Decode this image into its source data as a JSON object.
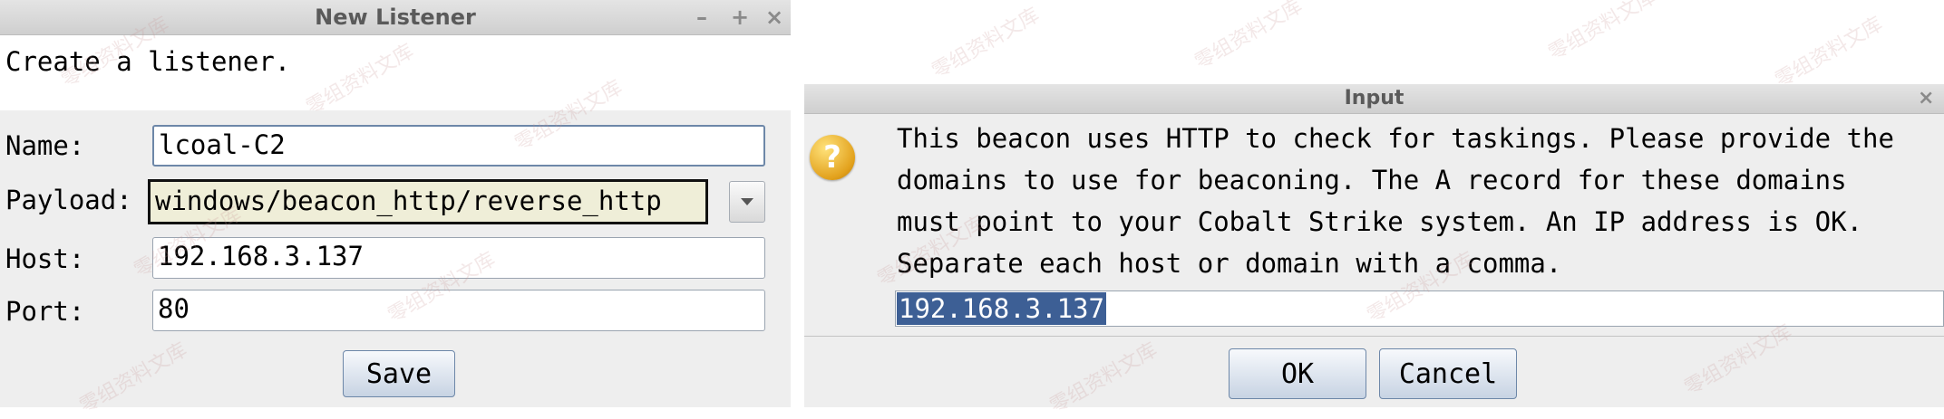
{
  "left_dialog": {
    "title": "New Listener",
    "controls": {
      "minimize": "–",
      "maximize": "+",
      "close": "×"
    },
    "description": "Create a listener.",
    "fields": {
      "name_label": "Name:",
      "name_value": "lcoal-C2",
      "payload_label": "Payload:",
      "payload_value": "windows/beacon_http/reverse_http",
      "host_label": "Host:",
      "host_value": "192.168.3.137",
      "port_label": "Port:",
      "port_value": "80"
    },
    "save_label": "Save"
  },
  "right_dialog": {
    "title": "Input",
    "close": "×",
    "icon": "question-icon",
    "icon_glyph": "?",
    "message_lines": [
      "This beacon uses HTTP to check for taskings. Please provide the",
      "domains to use for beaconing. The A record for these domains",
      "must point to your Cobalt Strike system. An IP address is OK.",
      "Separate each host or domain with a comma."
    ],
    "input_value": "192.168.3.137",
    "ok_label": "OK",
    "cancel_label": "Cancel"
  },
  "watermark_text": "零组资料文库",
  "colors": {
    "selection_bg": "#3d5f95",
    "button_border": "#6d87a8",
    "payload_highlight": "#efeed8",
    "icon": "#e2a11c"
  }
}
